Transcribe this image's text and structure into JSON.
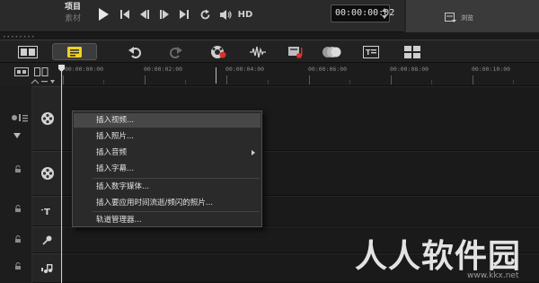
{
  "player": {
    "mode_project": "项目",
    "mode_clip": "素材",
    "hd_label": "HD",
    "timecode": "00:00:00:02",
    "browse_label": "浏览"
  },
  "ruler": {
    "ticks": [
      "00:00:00:00",
      "00:00:02:00",
      "00:00:04:00",
      "00:00:06:00",
      "00:00:08:00",
      "00:00:10:00"
    ]
  },
  "context_menu": {
    "items": [
      {
        "label": "插入视频...",
        "highlighted": true
      },
      {
        "label": "插入照片..."
      },
      {
        "label": "插入音频",
        "submenu": true
      },
      {
        "label": "插入字幕..."
      },
      {
        "label": "插入数字媒体..."
      },
      {
        "label": "插入要应用时间流逝/频闪的照片..."
      },
      {
        "label": "轨道管理器..."
      }
    ]
  },
  "watermark": {
    "text": "人人软件园",
    "url": "www.kkx.net"
  },
  "colors": {
    "background": "#1b1b1b",
    "menu_bg": "#2a2a2a",
    "menu_highlight": "#474747",
    "timeline_toggle": "#f2d21c",
    "fx_red": "#d8322a"
  },
  "icons": {
    "play": "play-icon",
    "home": "to-start-icon",
    "prev_frame": "prev-frame-icon",
    "next_frame": "next-frame-icon",
    "end": "to-end-icon",
    "repeat": "repeat-icon",
    "volume": "volume-icon",
    "undo": "undo-icon",
    "redo": "redo-icon",
    "record": "record-capture-icon",
    "sound_mixer": "sound-mixer-icon",
    "auto_music": "auto-music-icon",
    "motion_track": "motion-tracking-icon",
    "subtitle": "subtitle-editor-icon",
    "multicam": "multi-camera-icon"
  }
}
